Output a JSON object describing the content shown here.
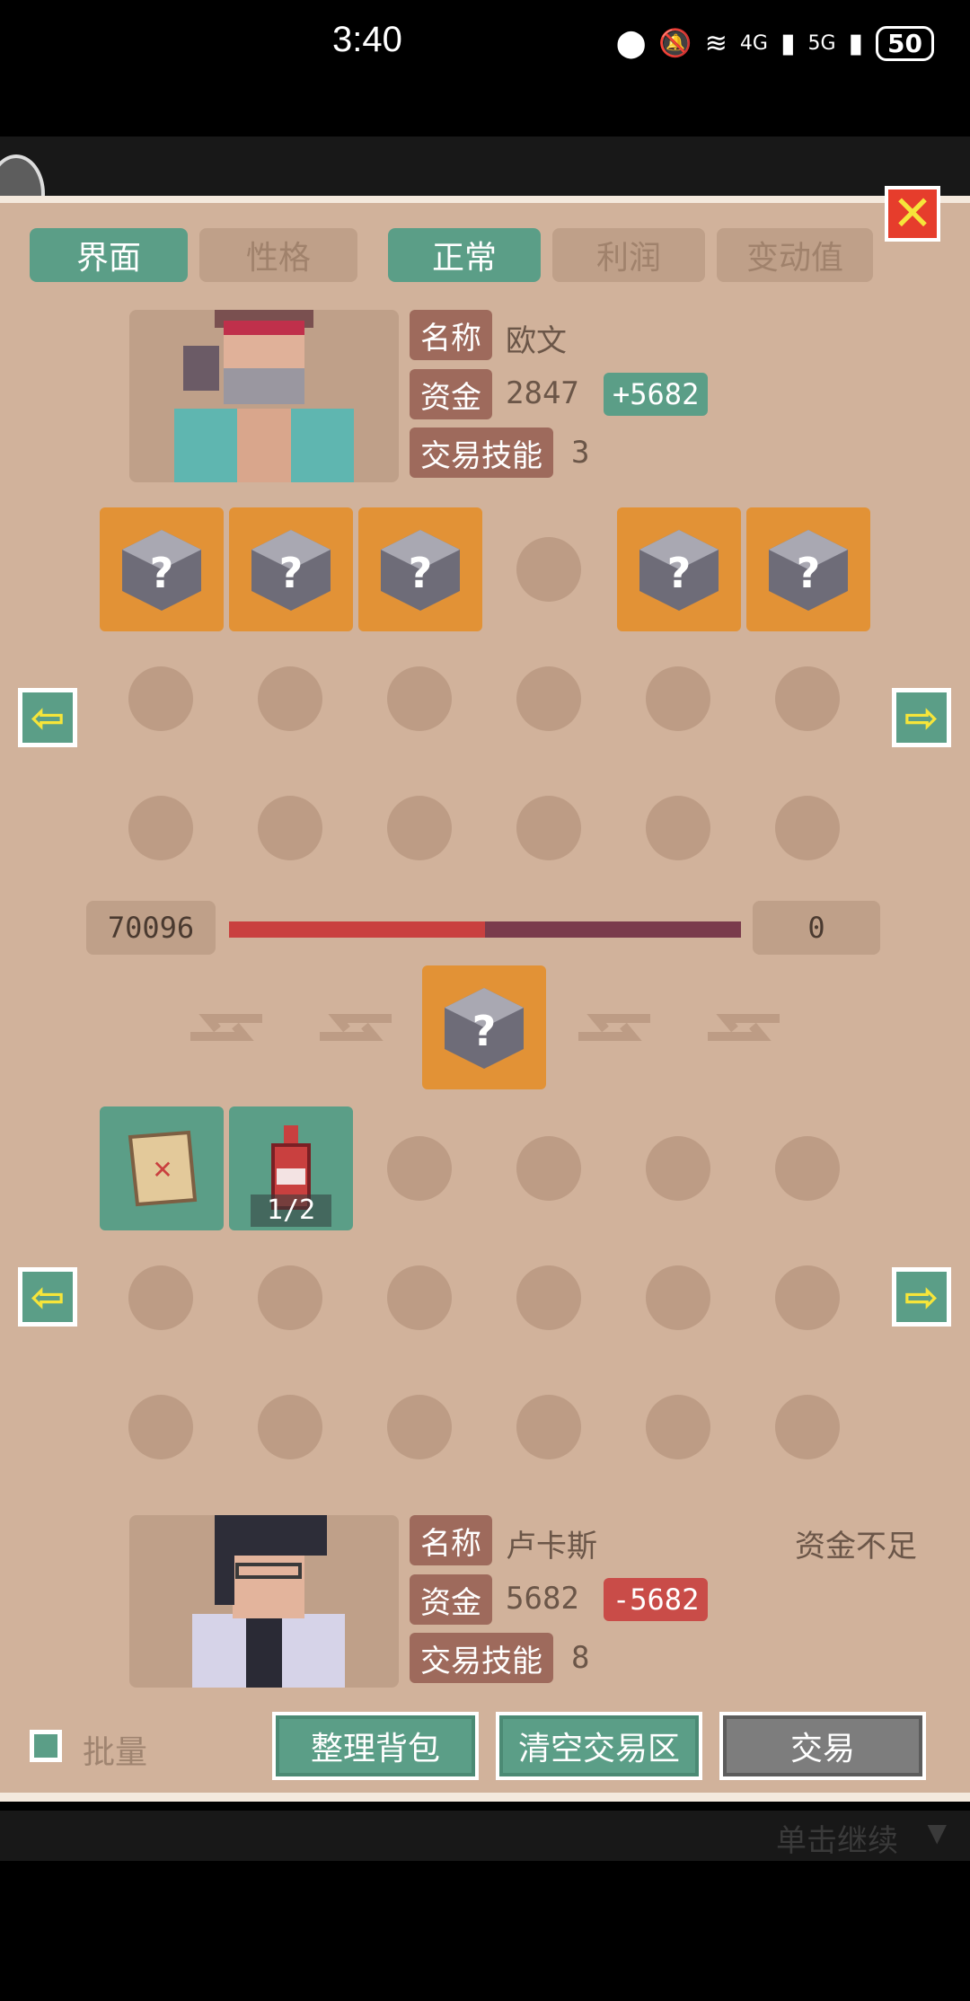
{
  "status_bar": {
    "time": "3:40",
    "battery": "50",
    "net1": "4G",
    "net2": "5G"
  },
  "tabs": [
    {
      "label": "界面",
      "active": true
    },
    {
      "label": "性格",
      "active": false
    },
    {
      "label": "正常",
      "active": true
    },
    {
      "label": "利润",
      "active": false
    },
    {
      "label": "变动值",
      "active": false
    }
  ],
  "merchant": {
    "name_label": "名称",
    "name": "欧文",
    "funds_label": "资金",
    "funds": "2847",
    "funds_delta": "+5682",
    "skill_label": "交易技能",
    "skill": "3"
  },
  "player": {
    "name_label": "名称",
    "name": "卢卡斯",
    "warning": "资金不足",
    "funds_label": "资金",
    "funds": "5682",
    "funds_delta": "-5682",
    "skill_label": "交易技能",
    "skill": "8"
  },
  "trade": {
    "left_value": "70096",
    "right_value": "0",
    "balance_fraction": 0.5
  },
  "inventory": {
    "bottle_count": "1/2"
  },
  "footer": {
    "batch_label": "批量",
    "sort_button": "整理背包",
    "clear_button": "清空交易区",
    "trade_button": "交易",
    "continue_hint": "单击继续"
  },
  "colors": {
    "accent_green": "#5b9e87",
    "slot_orange": "#e29236",
    "panel": "#d1b29b",
    "bad_red": "#c94c48"
  }
}
